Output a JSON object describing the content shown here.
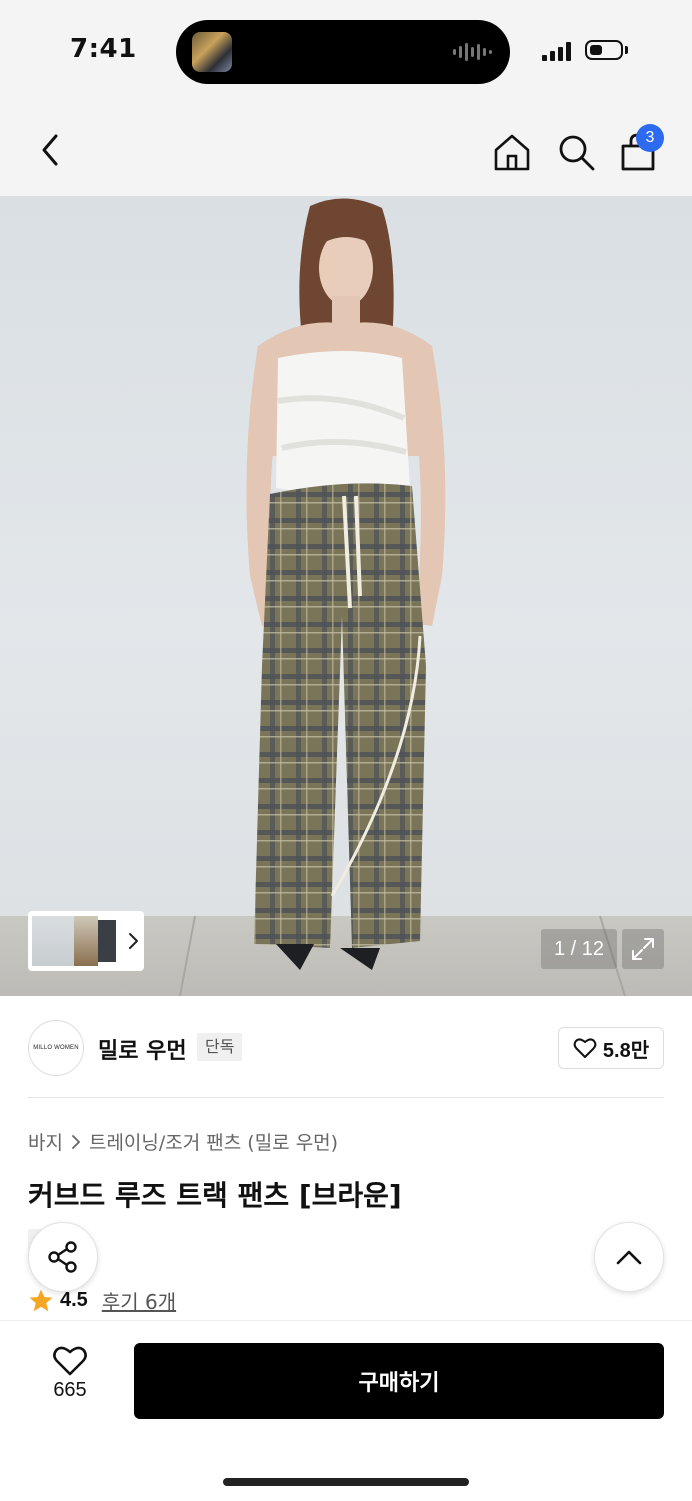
{
  "status_bar": {
    "time": "7:41"
  },
  "nav": {
    "back_icon": "chevron-left-icon",
    "home_icon": "home-icon",
    "search_icon": "search-icon",
    "cart_icon": "shopping-bag-icon",
    "cart_count": "3",
    "badge_color": "#2c6bf0"
  },
  "gallery": {
    "page_indicator": "1 / 12",
    "expand_icon": "expand-icon",
    "thumbnail_chevron_icon": "chevron-right-icon"
  },
  "brand": {
    "logo_text": "MILLO WOMEN",
    "name": "밀로 우먼",
    "tag": "단독",
    "likes": "5.8만"
  },
  "product": {
    "breadcrumb": [
      "바지",
      "트레이닝/조거 팬츠 (밀로 우먼)"
    ],
    "title": "커브드 루즈 트랙 팬츠 [브라운]",
    "exclusive_tag": "단독",
    "rating": "4.5",
    "reviews": "후기 6개"
  },
  "bottom_bar": {
    "like_count": "665",
    "buy_label": "구매하기"
  }
}
